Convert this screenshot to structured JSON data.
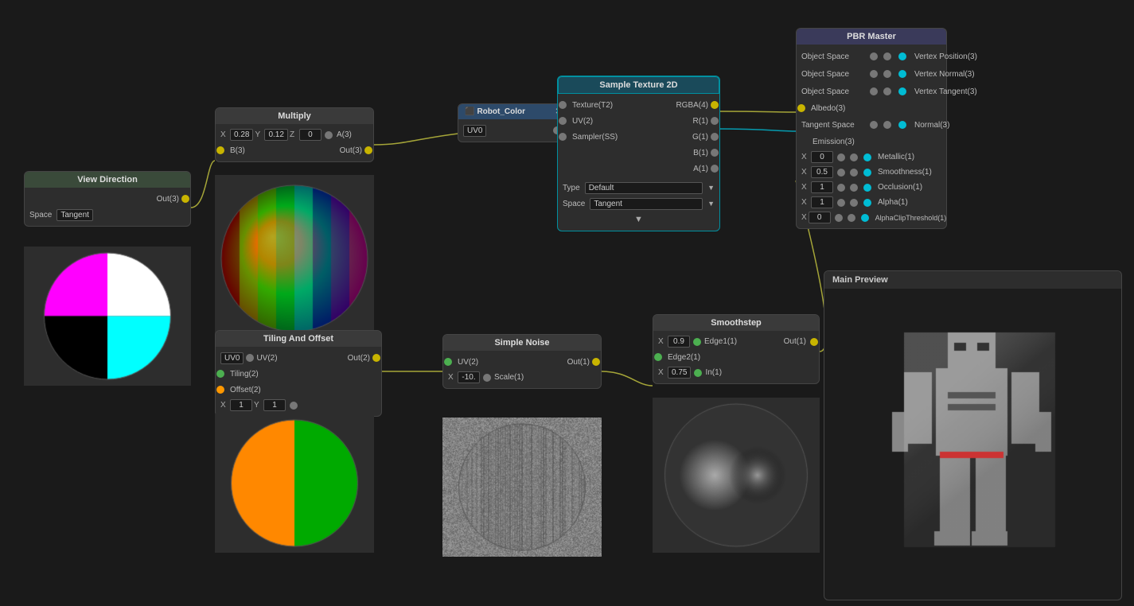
{
  "nodes": {
    "view_direction": {
      "title": "View Direction",
      "output_label": "Out(3)",
      "space_label": "Space",
      "space_value": "Tangent"
    },
    "multiply": {
      "title": "Multiply",
      "x_label": "X",
      "x_value": "0.28",
      "y_label": "Y",
      "y_value": "0.12",
      "z_label": "Z",
      "z_value": "0",
      "a_label": "A(3)",
      "b_label": "B(3)",
      "out_label": "Out(3)"
    },
    "tiling": {
      "title": "Tiling And Offset",
      "uv_value": "UV0",
      "uv_label": "UV(2)",
      "tiling_label": "Tiling(2)",
      "offset_label": "Offset(2)",
      "out_label": "Out(2)",
      "x_value": "1",
      "y_value": "1"
    },
    "robot_texture": {
      "title": "Robot_Color",
      "uv_value": "UV0"
    },
    "sample2d": {
      "title": "Sample Texture 2D",
      "texture_label": "Texture(T2)",
      "uv_label": "UV(2)",
      "sampler_label": "Sampler(SS)",
      "rgba_label": "RGBA(4)",
      "r_label": "R(1)",
      "g_label": "G(1)",
      "b_label": "B(1)",
      "a_label": "A(1)",
      "type_label": "Type",
      "type_value": "Default",
      "space_label": "Space",
      "space_value": "Tangent"
    },
    "simple_noise": {
      "title": "Simple Noise",
      "uv_label": "UV(2)",
      "scale_label": "Scale(1)",
      "out_label": "Out(1)",
      "x_value": "-10."
    },
    "smoothstep": {
      "title": "Smoothstep",
      "edge1_label": "Edge1(1)",
      "edge2_label": "Edge2(1)",
      "in_label": "In(1)",
      "out_label": "Out(1)",
      "x1_value": "0.9",
      "x2_value": "0.75"
    },
    "pbr_master": {
      "title": "PBR Master",
      "object_space_1": "Object Space",
      "object_space_2": "Object Space",
      "object_space_3": "Object Space",
      "tangent_space": "Tangent Space",
      "vertex_position": "Vertex Position(3)",
      "vertex_normal": "Vertex Normal(3)",
      "vertex_tangent": "Vertex Tangent(3)",
      "albedo": "Albedo(3)",
      "normal": "Normal(3)",
      "emission": "Emission(3)",
      "metallic": "Metallic(1)",
      "smoothness": "Smoothness(1)",
      "occlusion": "Occlusion(1)",
      "alpha": "Alpha(1)",
      "alpha_clip": "AlphaClipThreshold(1)",
      "x0": "0",
      "x05": "0.5",
      "x1a": "1",
      "x1b": "1",
      "x0b": "0"
    }
  },
  "main_preview": {
    "title": "Main Preview"
  }
}
